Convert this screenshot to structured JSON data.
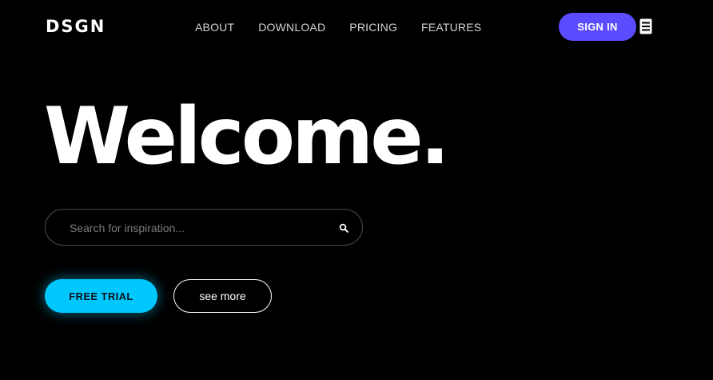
{
  "header": {
    "logo": "DSGN",
    "nav": [
      {
        "label": "ABOUT"
      },
      {
        "label": "DOWNLOAD"
      },
      {
        "label": "PRICING"
      },
      {
        "label": "FEATURES"
      }
    ],
    "sign_in_label": "SIGN IN",
    "menu_icon": "menu-icon"
  },
  "hero": {
    "title": "Welcome."
  },
  "search": {
    "placeholder": "Search for inspiration...",
    "value": "",
    "icon": "search-icon"
  },
  "actions": {
    "free_trial_label": "FREE TRIAL",
    "see_more_label": "see more"
  },
  "colors": {
    "background": "#000000",
    "sign_in": "#5b4dff",
    "free_trial": "#00c8ff",
    "text": "#ffffff"
  }
}
